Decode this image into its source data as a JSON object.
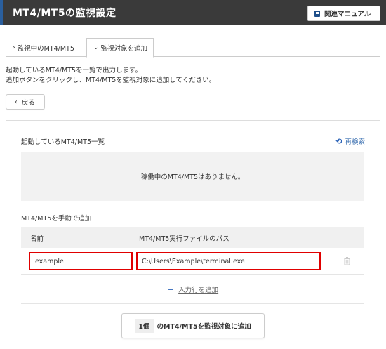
{
  "header": {
    "title": "MT4/MT5の監視設定",
    "manual_label": "関連マニュアル"
  },
  "tabs": [
    {
      "label": "監視中のMT4/MT5",
      "chevron": "›",
      "active": false
    },
    {
      "label": "監視対象を追加",
      "chevron": "⌄",
      "active": true
    }
  ],
  "description": [
    "起動しているMT4/MT5を一覧で出力します。",
    "追加ボタンをクリックし、MT4/MT5を監視対象に追加してください。"
  ],
  "back_button": {
    "label": "戻る",
    "icon": "‹"
  },
  "running_list": {
    "title": "起動しているMT4/MT5一覧",
    "rescan_label": "再検索",
    "rescan_icon": "⟲",
    "empty_message": "稼働中のMT4/MT5はありません。"
  },
  "manual_add": {
    "title": "MT4/MT5を手動で追加",
    "columns": [
      "名前",
      "MT4/MT5実行ファイルのパス"
    ],
    "rows": [
      {
        "name": "example",
        "path": "C:\\Users\\Example\\terminal.exe"
      }
    ],
    "add_row_label": "入力行を追加",
    "add_row_icon": "+"
  },
  "submit": {
    "count": "1個",
    "label": "のMT4/MT5を監視対象に追加"
  },
  "colors": {
    "header_bg": "#3a3a3a",
    "accent": "#2a5f9e",
    "highlight": "#e00000",
    "link": "#2b63b8"
  }
}
